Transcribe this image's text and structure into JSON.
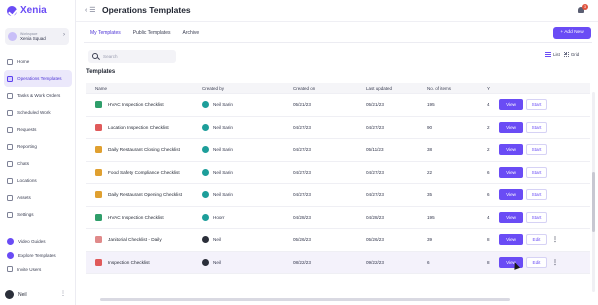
{
  "app": {
    "brand": "Xenia"
  },
  "workspace": {
    "label": "Workspace",
    "name": "Xenia Squad"
  },
  "sidebar": {
    "items": [
      {
        "label": "Home",
        "active": false
      },
      {
        "label": "Operations Templates",
        "active": true
      },
      {
        "label": "Tasks & Work Orders",
        "active": false
      },
      {
        "label": "Scheduled Work",
        "active": false
      },
      {
        "label": "Requests",
        "active": false
      },
      {
        "label": "Reporting",
        "active": false
      },
      {
        "label": "Chats",
        "active": false
      },
      {
        "label": "Locations",
        "active": false
      },
      {
        "label": "Assets",
        "active": false
      },
      {
        "label": "Settings",
        "active": false
      }
    ],
    "bottom_items": [
      {
        "label": "Video Guides"
      },
      {
        "label": "Explore Templates"
      },
      {
        "label": "Invite Users"
      }
    ],
    "user": {
      "name": "Neil"
    }
  },
  "header": {
    "title": "Operations Templates",
    "notification_count": "3"
  },
  "tabs": [
    {
      "label": "My Templates",
      "active": true
    },
    {
      "label": "Public Templates",
      "active": false
    },
    {
      "label": "Archive",
      "active": false
    }
  ],
  "toolbar": {
    "add_label": "+ Add New",
    "list_label": "List",
    "grid_label": "Grid"
  },
  "search": {
    "placeholder": "Search"
  },
  "section": {
    "title": "Templates"
  },
  "table": {
    "columns": [
      "Name",
      "Created by",
      "Created on",
      "Last updated",
      "No. of items",
      "Y"
    ],
    "rows": [
      {
        "name": "HVAC Inspection Checklist",
        "creator": "Neil Sarin",
        "created": "05/21/23",
        "updated": "05/21/23",
        "items": "195",
        "sub": "4",
        "action": "Start",
        "icon_color": "#2f9e6a"
      },
      {
        "name": "Location Inspection Checklist",
        "creator": "Neil Sarin",
        "created": "04/27/23",
        "updated": "04/27/23",
        "items": "90",
        "sub": "2",
        "action": "Start",
        "icon_color": "#e05a5a"
      },
      {
        "name": "Daily Restaurant Closing Checklist",
        "creator": "Neil Sarin",
        "created": "04/27/23",
        "updated": "05/11/23",
        "items": "38",
        "sub": "2",
        "action": "Start",
        "icon_color": "#e0a030"
      },
      {
        "name": "Food Safety Compliance Checklist",
        "creator": "Neil Sarin",
        "created": "04/27/23",
        "updated": "04/27/23",
        "items": "22",
        "sub": "6",
        "action": "Start",
        "icon_color": "#e0a030"
      },
      {
        "name": "Daily Restaurant Opening Checklist",
        "creator": "Neil Sarin",
        "created": "04/27/23",
        "updated": "04/27/23",
        "items": "35",
        "sub": "6",
        "action": "Start",
        "icon_color": "#e0a030"
      },
      {
        "name": "HVAC Inspection Checklist",
        "creator": "Hoorr",
        "created": "04/28/23",
        "updated": "04/28/23",
        "items": "195",
        "sub": "4",
        "action": "Start",
        "icon_color": "#2f9e6a"
      },
      {
        "name": "Janitorial Checklist - Daily",
        "creator": "Neil",
        "created": "05/26/23",
        "updated": "05/26/23",
        "items": "39",
        "sub": "8",
        "action": "Edit",
        "icon_color": "#e08a8a"
      },
      {
        "name": "Inspection Checklist",
        "creator": "Neil",
        "created": "08/22/23",
        "updated": "09/22/23",
        "items": "6",
        "sub": "8",
        "action": "Edit",
        "icon_color": "#e05a5a"
      }
    ],
    "view_label": "View"
  },
  "colors": {
    "accent": "#6a4cf5"
  }
}
